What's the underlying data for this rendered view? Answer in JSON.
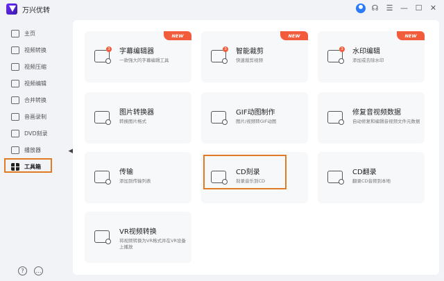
{
  "app": {
    "title": "万兴优转"
  },
  "titlebar_icons": [
    "user-icon",
    "headset-icon",
    "menu-icon",
    "minimize-icon",
    "maximize-icon",
    "close-icon"
  ],
  "sidebar": {
    "items": [
      {
        "label": "主页",
        "icon": "home-icon"
      },
      {
        "label": "视频转换",
        "icon": "video-convert-icon"
      },
      {
        "label": "视频压缩",
        "icon": "compress-icon"
      },
      {
        "label": "视频编辑",
        "icon": "scissors-icon"
      },
      {
        "label": "合并转换",
        "icon": "merge-icon"
      },
      {
        "label": "音画录制",
        "icon": "record-icon"
      },
      {
        "label": "DVD刻录",
        "icon": "disc-icon"
      },
      {
        "label": "播放器",
        "icon": "player-icon"
      },
      {
        "label": "工具箱",
        "icon": "toolbox-icon",
        "active": true
      }
    ],
    "bottom": [
      "help-icon",
      "feedback-icon"
    ]
  },
  "tools": [
    {
      "title": "字幕编辑器",
      "desc": "一款强大的字幕编辑工具",
      "badge": "NEW",
      "dot": "3",
      "icon": "subtitle-icon"
    },
    {
      "title": "智能裁剪",
      "desc": "快速裁剪视频",
      "badge": "NEW",
      "dot": "3",
      "icon": "ai-crop-icon"
    },
    {
      "title": "水印编辑",
      "desc": "添加或去除水印",
      "badge": "NEW",
      "dot": "3",
      "icon": "watermark-icon"
    },
    {
      "title": "图片转换器",
      "desc": "转换图片格式",
      "icon": "image-convert-icon"
    },
    {
      "title": "GIF动图制作",
      "desc": "图片/视频转GIF动图",
      "icon": "gif-icon"
    },
    {
      "title": "修复音视频数据",
      "desc": "自动修复和编辑音视频文件元数据",
      "icon": "repair-icon"
    },
    {
      "title": "传输",
      "desc": "添加到传输列表",
      "icon": "transfer-icon"
    },
    {
      "title": "CD刻录",
      "desc": "刻录音乐到CD",
      "icon": "cd-burn-icon"
    },
    {
      "title": "CD翻录",
      "desc": "翻录CD音频到本地",
      "icon": "cd-rip-icon"
    },
    {
      "title": "VR视频转换",
      "desc": "将视频转换为VR格式并在VR设备上播放",
      "icon": "vr-icon"
    }
  ],
  "colors": {
    "accent": "#e07a23",
    "badge": "#f25c3c",
    "brand": "#5a24e0"
  }
}
